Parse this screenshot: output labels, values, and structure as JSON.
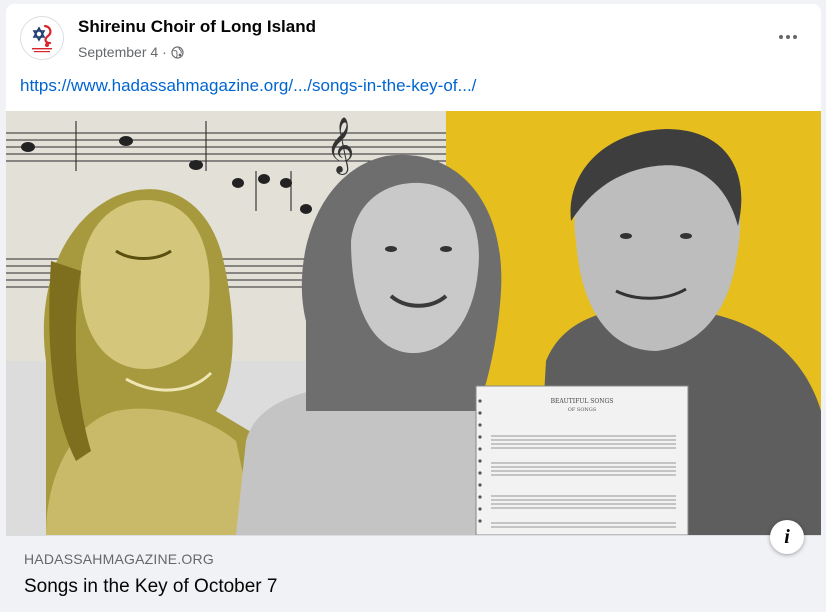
{
  "post": {
    "page_name": "Shireinu Choir of Long Island",
    "date": "September 4",
    "separator": "·",
    "audience_icon": "globe-icon",
    "more_icon": "more-options-icon",
    "link_text": "https://www.hadassahmagazine.org/.../songs-in-the-key-of.../"
  },
  "media": {
    "sheet_title": "BEAUTIFUL SONGS",
    "sheet_subtitle": "OF SONGS"
  },
  "link_preview": {
    "domain": "HADASSAHMAGAZINE.ORG",
    "title": "Songs in the Key of October 7",
    "info_label": "i",
    "info_icon": "info-icon"
  },
  "colors": {
    "link": "#0064d1",
    "name": "#050505",
    "meta": "#65676b",
    "preview_bg": "#f0f2f5",
    "accent_yellow": "#e6bf1e",
    "logo_red": "#d8242c"
  }
}
